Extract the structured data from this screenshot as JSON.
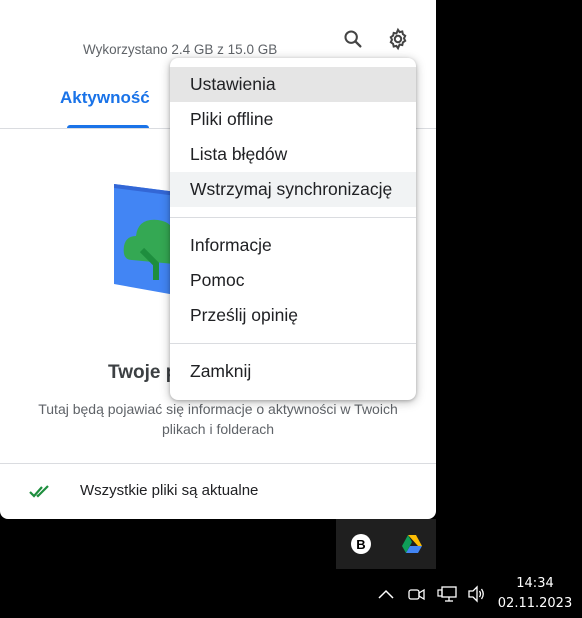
{
  "header": {
    "storage": "Wykorzystano 2.4 GB z 15.0 GB",
    "search_icon": "search-icon",
    "settings_icon": "gear-icon"
  },
  "tabs": [
    {
      "label": "Aktywność",
      "active": true
    }
  ],
  "empty_state": {
    "title_visible": "Twoje p",
    "description": "Tutaj będą pojawiać się informacje o aktywności w Twoich plikach i folderach"
  },
  "footer": {
    "status": "Wszystkie pliki są aktualne",
    "icon": "double-check-icon"
  },
  "menu": {
    "items": [
      "Ustawienia",
      "Pliki offline",
      "Lista błędów",
      "Wstrzymaj synchronizację"
    ],
    "items2": [
      "Informacje",
      "Pomoc",
      "Prześlij opinię"
    ],
    "items3": [
      "Zamknij"
    ]
  },
  "tray": {
    "b_label": "B",
    "icons": [
      "brave-b-icon",
      "google-drive-icon"
    ]
  },
  "taskbar": {
    "time": "14:34",
    "date": "02.11.2023",
    "icons": [
      "chevron-up-icon",
      "meet-now-icon",
      "network-icon",
      "volume-icon"
    ]
  },
  "colors": {
    "accent": "#1a73e8",
    "success": "#1e8e3e"
  }
}
